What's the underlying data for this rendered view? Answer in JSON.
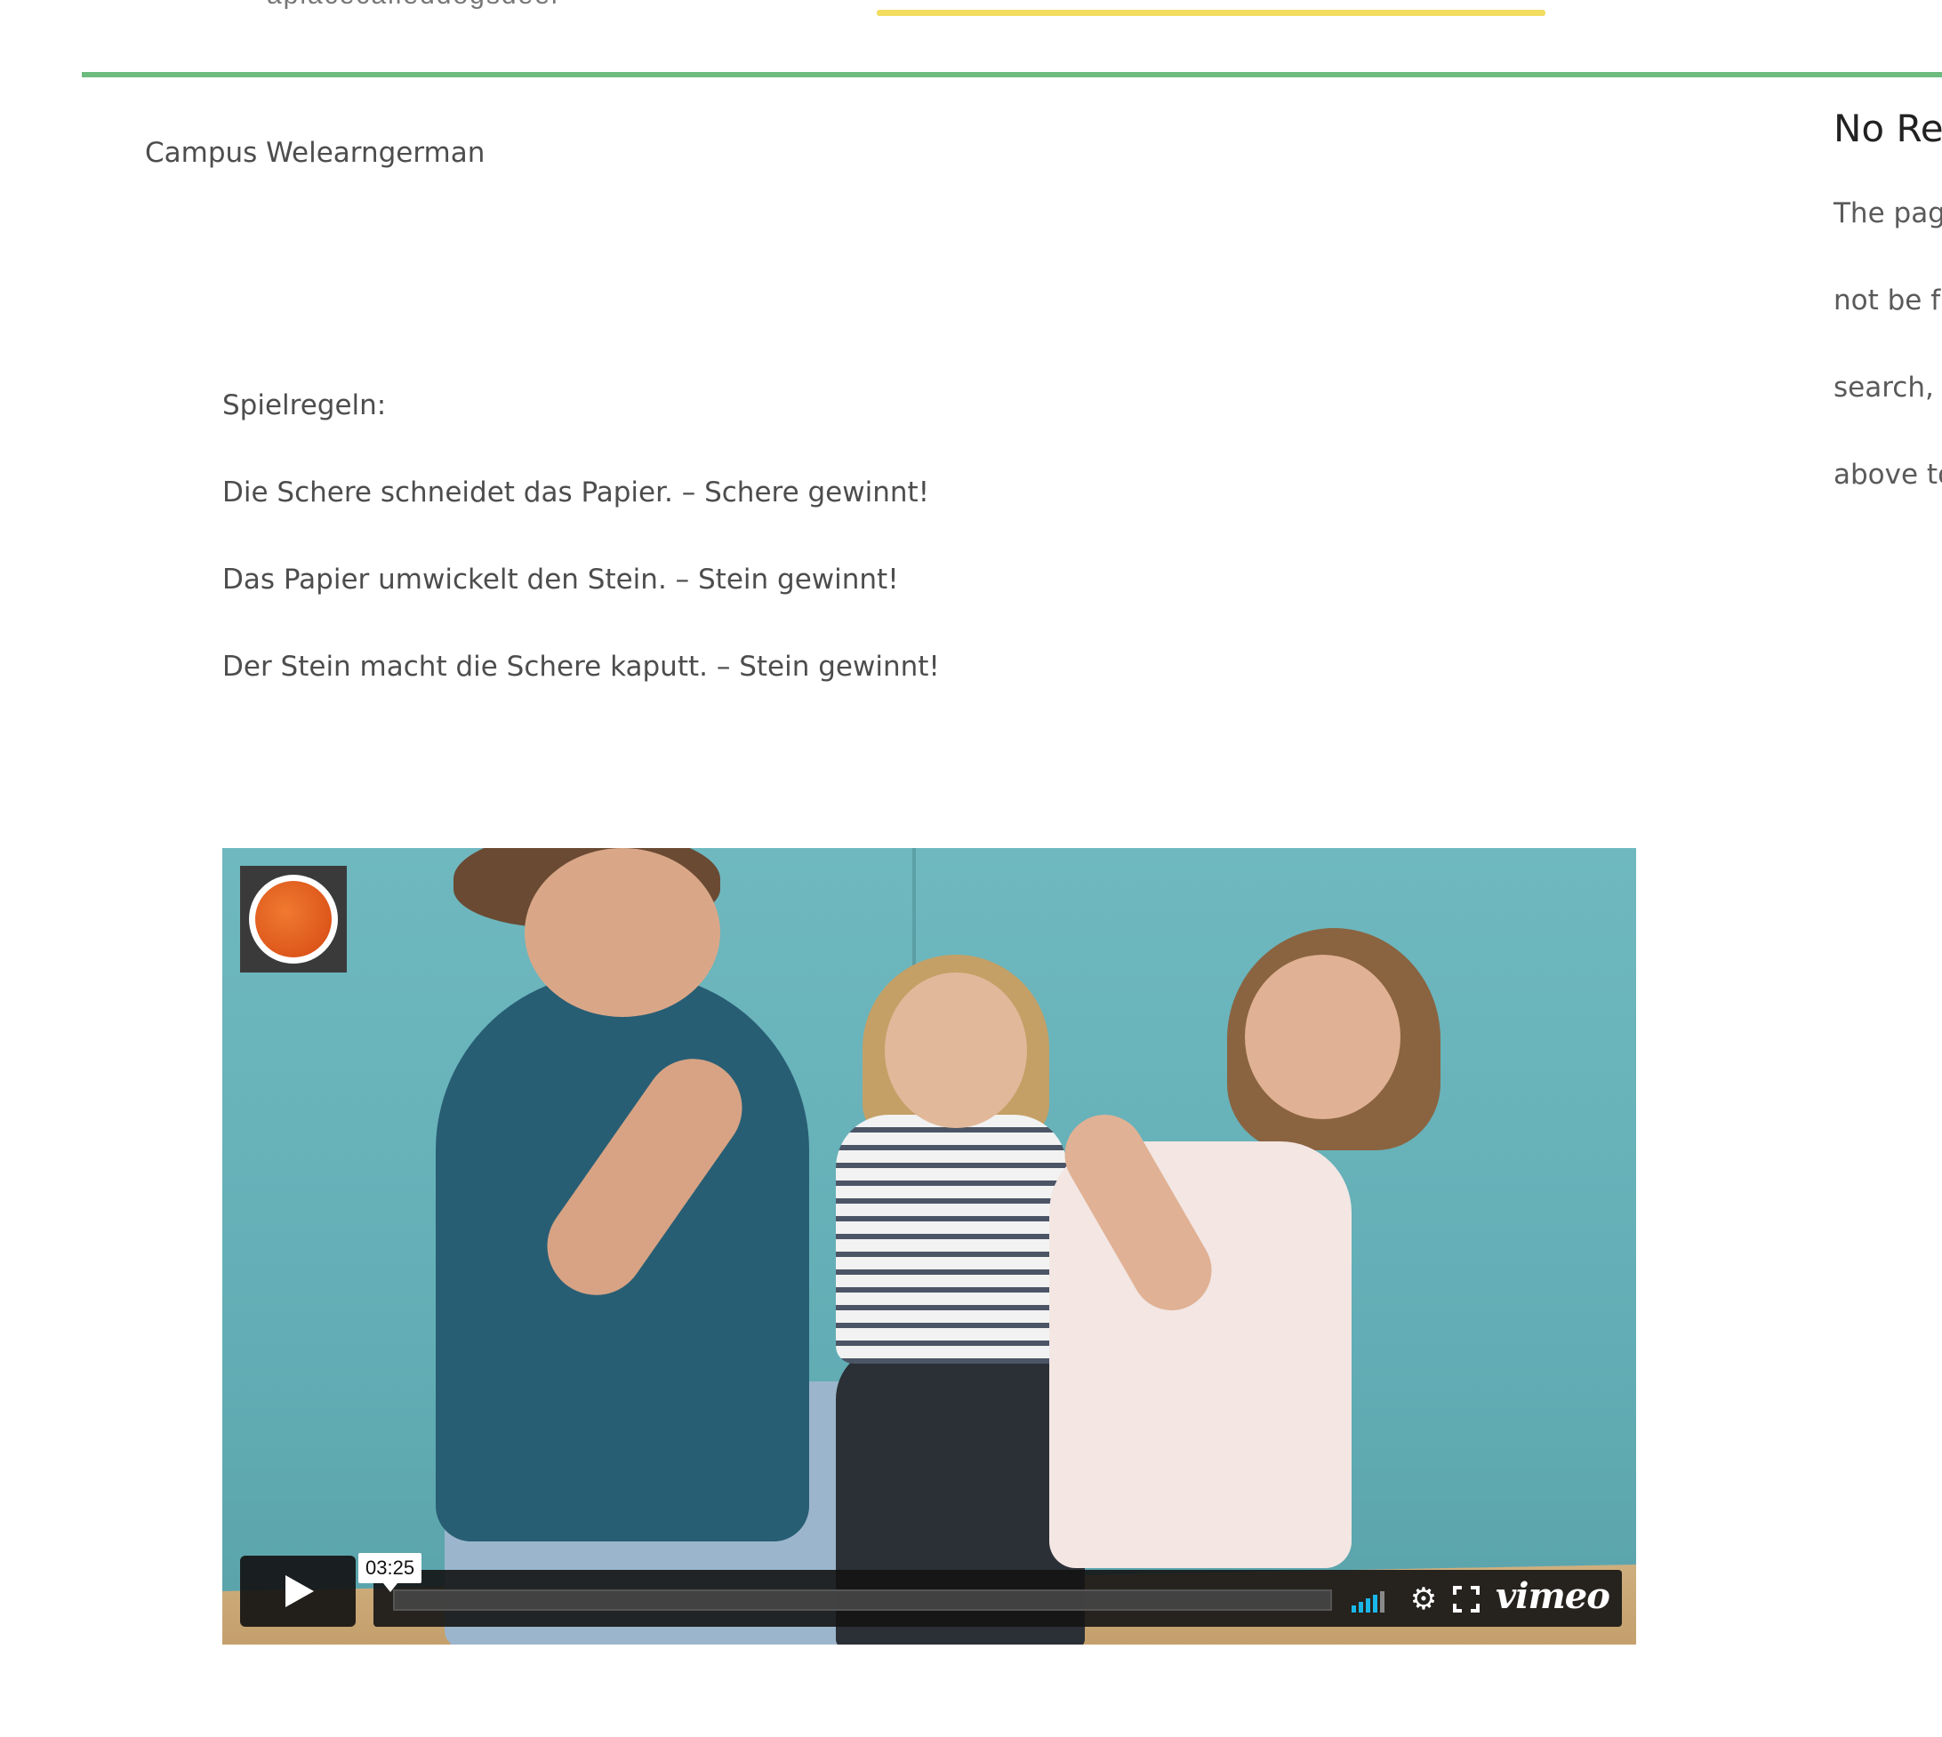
{
  "header": {
    "cut_off_text": "aplacecalleddogsdeer"
  },
  "breadcrumb": {
    "label": "Campus Welearngerman"
  },
  "article": {
    "heading": "Spielregeln:",
    "rules": [
      "Die Schere schneidet das Papier. – Schere gewinnt!",
      "Das Papier umwickelt den Stein. – Stein gewinnt!",
      "Der Stein macht die Schere kaputt. – Stein gewinnt!"
    ]
  },
  "sidebar": {
    "title": "No Re",
    "lines": [
      "The pag",
      "not be f",
      "search, c",
      "above to"
    ]
  },
  "video": {
    "duration": "03:25",
    "brand": "vimeo",
    "progress": 0,
    "volume_level": 0.8,
    "accent_color": "#1ab7ea"
  },
  "colors": {
    "green_divider": "#6dbb7e",
    "yellow_tab": "#f2dd60"
  }
}
